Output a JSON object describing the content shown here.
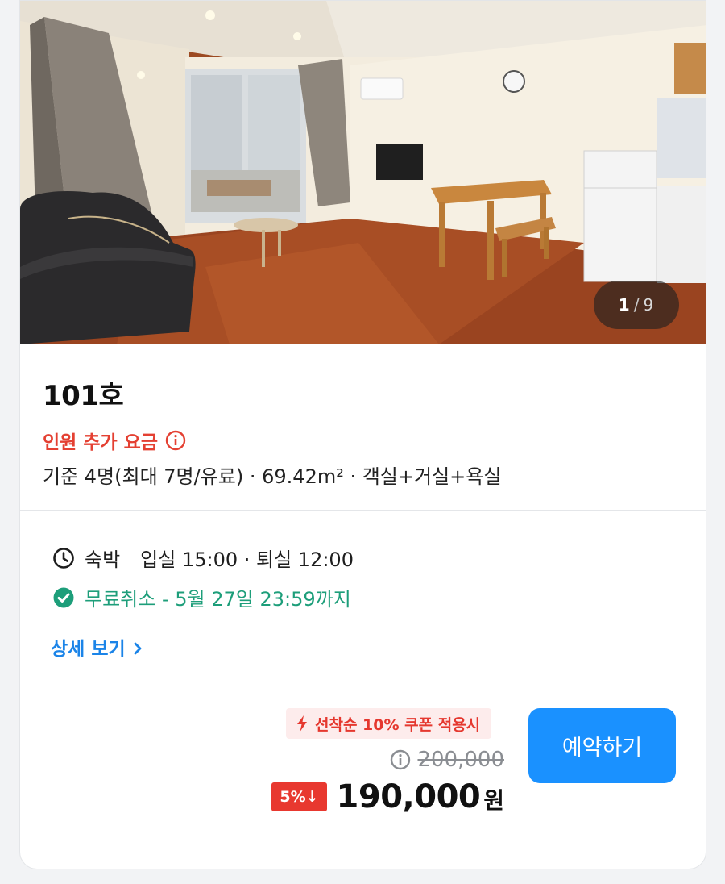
{
  "photo": {
    "pager_current": "1",
    "pager_separator": "/",
    "pager_total": "9"
  },
  "room": {
    "name": "101호",
    "extra_fee_label": "인원 추가 요금",
    "specs": "기준 4명(최대 7명/유료) · 69.42m² · 객실+거실+욕실"
  },
  "stay": {
    "type": "숙박",
    "times": "입실 15:00 · 퇴실 12:00",
    "cancel": "무료취소 - 5월 27일 23:59까지",
    "detail_link": "상세 보기"
  },
  "price": {
    "coupon": "선착순 10% 쿠폰 적용시",
    "original": "200,000",
    "discount_badge": "5%↓",
    "final": "190,000",
    "currency": "원"
  },
  "actions": {
    "book_label": "예약하기"
  },
  "colors": {
    "accent_blue": "#1a91ff",
    "alert_red": "#e44032",
    "success_green": "#1d9e7a",
    "link_blue": "#1b84e8"
  },
  "icons": {
    "extra_fee": "info-circle-icon",
    "stay": "clock-icon",
    "cancel": "check-circle-icon",
    "coupon": "lightning-icon",
    "original_price": "info-circle-icon"
  }
}
